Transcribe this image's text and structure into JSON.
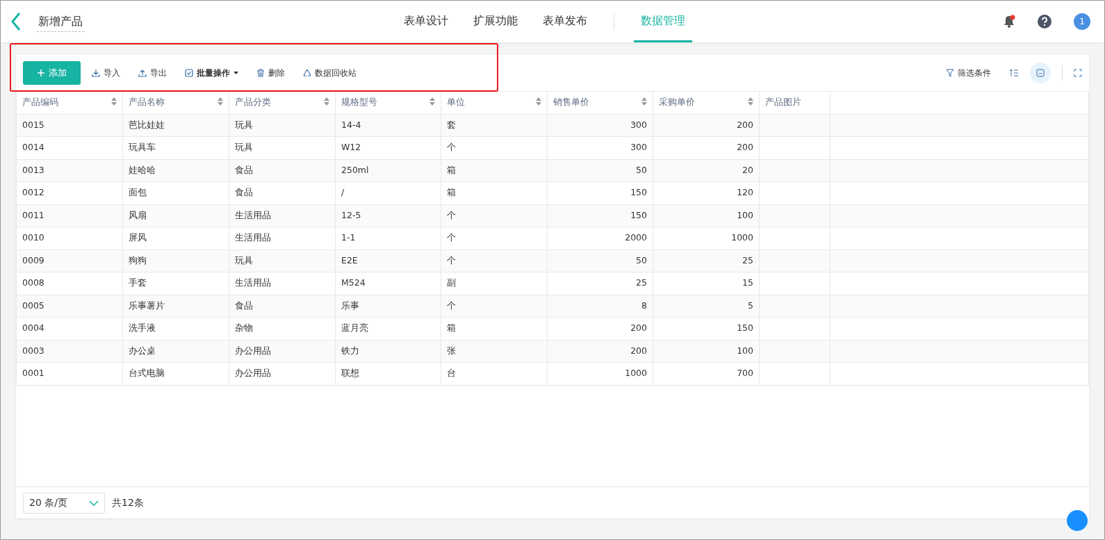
{
  "header": {
    "title": "新增产品",
    "tabs": [
      {
        "label": "表单设计",
        "selected": false
      },
      {
        "label": "扩展功能",
        "selected": false
      },
      {
        "label": "表单发布",
        "selected": false
      },
      {
        "label": "数据管理",
        "selected": true
      }
    ],
    "notifications": {
      "unread": true
    },
    "avatar": "1"
  },
  "toolbar": {
    "actions": [
      {
        "label": "添加",
        "kind": "primary"
      },
      {
        "label": "导入",
        "kind": "plain"
      },
      {
        "label": "导出",
        "kind": "plain"
      },
      {
        "label": "批量操作",
        "kind": "dropdown"
      },
      {
        "label": "删除",
        "kind": "plain"
      },
      {
        "label": "数据回收站",
        "kind": "plain"
      }
    ],
    "filter": "筛选条件",
    "view_toggle_selected": true
  },
  "table": {
    "columns": [
      {
        "label": "产品编码",
        "sortable": true,
        "kind": "text"
      },
      {
        "label": "产品名称",
        "sortable": true,
        "kind": "text"
      },
      {
        "label": "产品分类",
        "sortable": true,
        "kind": "text"
      },
      {
        "label": "规格型号",
        "sortable": true,
        "kind": "text"
      },
      {
        "label": "单位",
        "sortable": true,
        "kind": "text"
      },
      {
        "label": "销售单价",
        "sortable": true,
        "kind": "number"
      },
      {
        "label": "采购单价",
        "sortable": true,
        "kind": "number"
      },
      {
        "label": "产品图片",
        "sortable": false,
        "kind": "image"
      }
    ],
    "rows": [
      [
        "0015",
        "芭比娃娃",
        "玩具",
        "14-4",
        "套",
        "300",
        "200"
      ],
      [
        "0014",
        "玩具车",
        "玩具",
        "W12",
        "个",
        "300",
        "200"
      ],
      [
        "0013",
        "娃哈哈",
        "食品",
        "250ml",
        "箱",
        "50",
        "20"
      ],
      [
        "0012",
        "面包",
        "食品",
        "/",
        "箱",
        "150",
        "120"
      ],
      [
        "0011",
        "风扇",
        "生活用品",
        "12-5",
        "个",
        "150",
        "100"
      ],
      [
        "0010",
        "屏风",
        "生活用品",
        "1-1",
        "个",
        "2000",
        "1000"
      ],
      [
        "0009",
        "狗狗",
        "玩具",
        "E2E",
        "个",
        "50",
        "25"
      ],
      [
        "0008",
        "手套",
        "生活用品",
        "M524",
        "副",
        "25",
        "15"
      ],
      [
        "0005",
        "乐事薯片",
        "食品",
        "乐事",
        "个",
        "8",
        "5"
      ],
      [
        "0004",
        "洗手液",
        "杂物",
        "蓝月亮",
        "箱",
        "200",
        "150"
      ],
      [
        "0003",
        "办公桌",
        "办公用品",
        "铁力",
        "张",
        "200",
        "100"
      ],
      [
        "0001",
        "台式电脑",
        "办公用品",
        "联想",
        "台",
        "1000",
        "700"
      ]
    ]
  },
  "footer": {
    "page_size": "20 条/页",
    "total": "共12条"
  }
}
